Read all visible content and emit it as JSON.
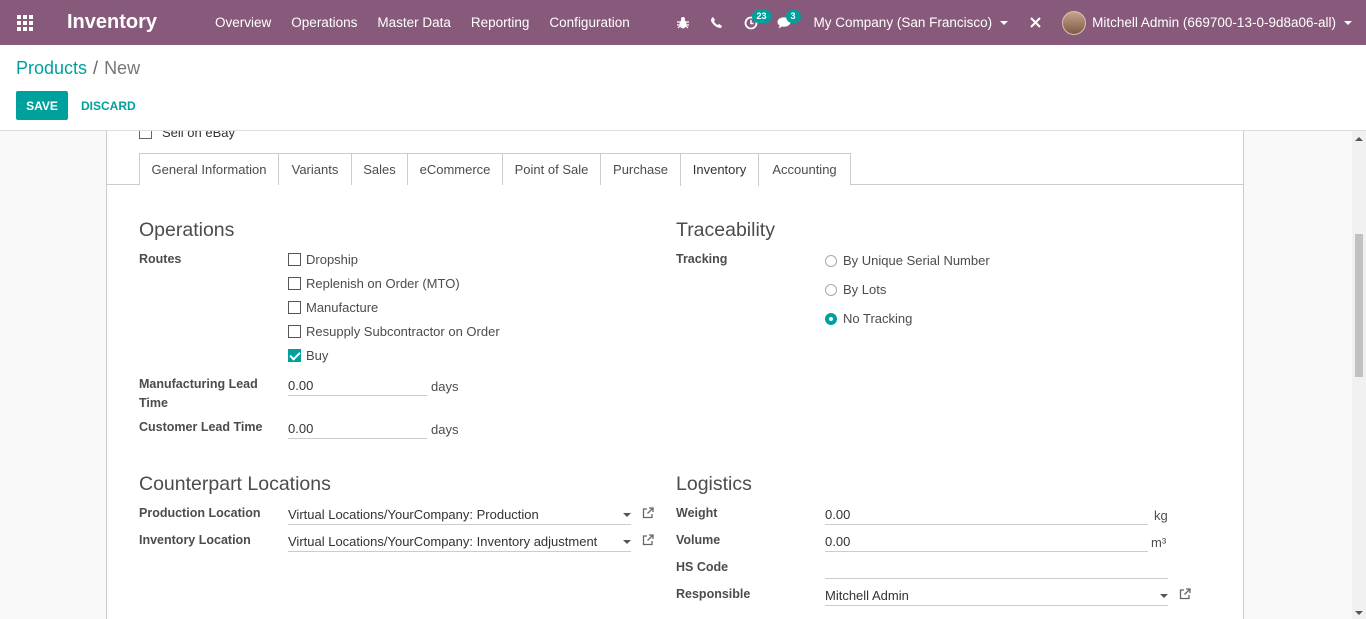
{
  "navbar": {
    "app_name": "Inventory",
    "menu": [
      "Overview",
      "Operations",
      "Master Data",
      "Reporting",
      "Configuration"
    ],
    "activity_count": "23",
    "message_count": "3",
    "company": "My Company (San Francisco)",
    "user": "Mitchell Admin (669700-13-0-9d8a06-all)"
  },
  "breadcrumb": {
    "parent": "Products",
    "separator": "/",
    "current": "New"
  },
  "buttons": {
    "save": "SAVE",
    "discard": "DISCARD"
  },
  "sheet": {
    "cutoff_label": "Sell on eBay"
  },
  "tabs": [
    "General Information",
    "Variants",
    "Sales",
    "eCommerce",
    "Point of Sale",
    "Purchase",
    "Inventory",
    "Accounting"
  ],
  "active_tab": "Inventory",
  "operations": {
    "title": "Operations",
    "routes_label": "Routes",
    "routes": [
      {
        "label": "Dropship",
        "checked": false
      },
      {
        "label": "Replenish on Order (MTO)",
        "checked": false
      },
      {
        "label": "Manufacture",
        "checked": false
      },
      {
        "label": "Resupply Subcontractor on Order",
        "checked": false
      },
      {
        "label": "Buy",
        "checked": true
      }
    ],
    "mfg_lead_label": "Manufacturing Lead Time",
    "mfg_lead_value": "0.00",
    "mfg_lead_unit": "days",
    "customer_lead_label": "Customer Lead Time",
    "customer_lead_value": "0.00",
    "customer_lead_unit": "days"
  },
  "traceability": {
    "title": "Traceability",
    "tracking_label": "Tracking",
    "options": [
      {
        "label": "By Unique Serial Number",
        "checked": false
      },
      {
        "label": "By Lots",
        "checked": false
      },
      {
        "label": "No Tracking",
        "checked": true
      }
    ]
  },
  "counterpart": {
    "title": "Counterpart Locations",
    "production_label": "Production Location",
    "production_value": "Virtual Locations/YourCompany: Production",
    "inventory_label": "Inventory Location",
    "inventory_value": "Virtual Locations/YourCompany: Inventory adjustment"
  },
  "logistics": {
    "title": "Logistics",
    "weight_label": "Weight",
    "weight_value": "0.00",
    "weight_unit": "kg",
    "volume_label": "Volume",
    "volume_value": "0.00",
    "volume_unit": "m³",
    "hs_code_label": "HS Code",
    "hs_code_value": "",
    "responsible_label": "Responsible",
    "responsible_value": "Mitchell Admin"
  },
  "colors": {
    "navbar": "#875a7b",
    "accent": "#00a09d"
  }
}
